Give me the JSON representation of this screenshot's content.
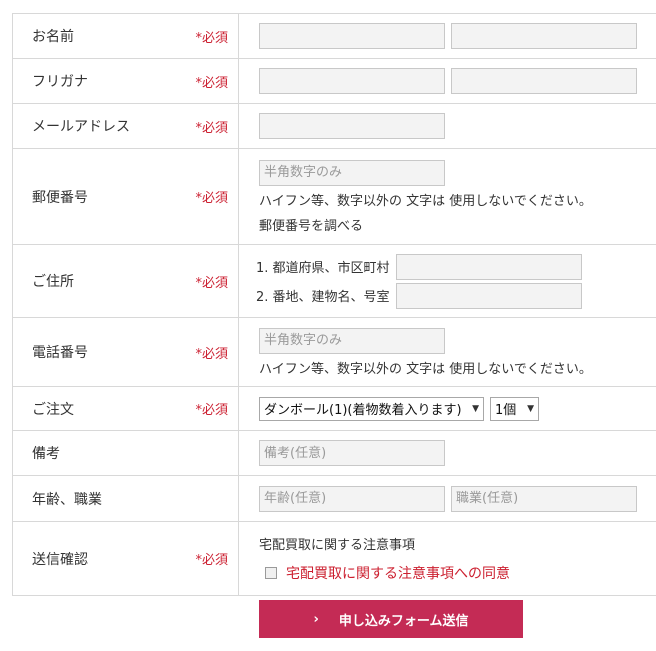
{
  "required_mark": "*必須",
  "rows": {
    "name": {
      "label": "お名前"
    },
    "furigana": {
      "label": "フリガナ"
    },
    "email": {
      "label": "メールアドレス"
    },
    "postal": {
      "label": "郵便番号",
      "placeholder": "半角数字のみ",
      "note": "ハイフン等、数字以外の 文字は 使用しないでください。",
      "lookup_link": "郵便番号を調べる"
    },
    "address": {
      "label": "ご住所",
      "line1_label": "1. 都道府県、市区町村",
      "line2_label": "2. 番地、建物名、号室"
    },
    "phone": {
      "label": "電話番号",
      "placeholder": "半角数字のみ",
      "note": "ハイフン等、数字以外の 文字は 使用しないでください。"
    },
    "order": {
      "label": "ご注文",
      "product_selected": "ダンボール(1)(着物数着入ります)",
      "quantity_selected": "1個"
    },
    "remarks": {
      "label": "備考",
      "placeholder": "備考(任意)"
    },
    "age_job": {
      "label": "年齢、職業",
      "age_placeholder": "年齢(任意)",
      "job_placeholder": "職業(任意)"
    },
    "confirm": {
      "label": "送信確認",
      "notice_title": "宅配買取に関する注意事項",
      "consent_label": "宅配買取に関する注意事項への同意"
    }
  },
  "submit_label": "申し込みフォーム送信",
  "icons": {
    "submit": "chevron-right-icon",
    "select": "chevron-down-icon"
  },
  "colors": {
    "required": "#cc2233",
    "submit_bg": "#c42b55",
    "field_bg": "#f3f3f3",
    "border": "#d8d8d8"
  }
}
